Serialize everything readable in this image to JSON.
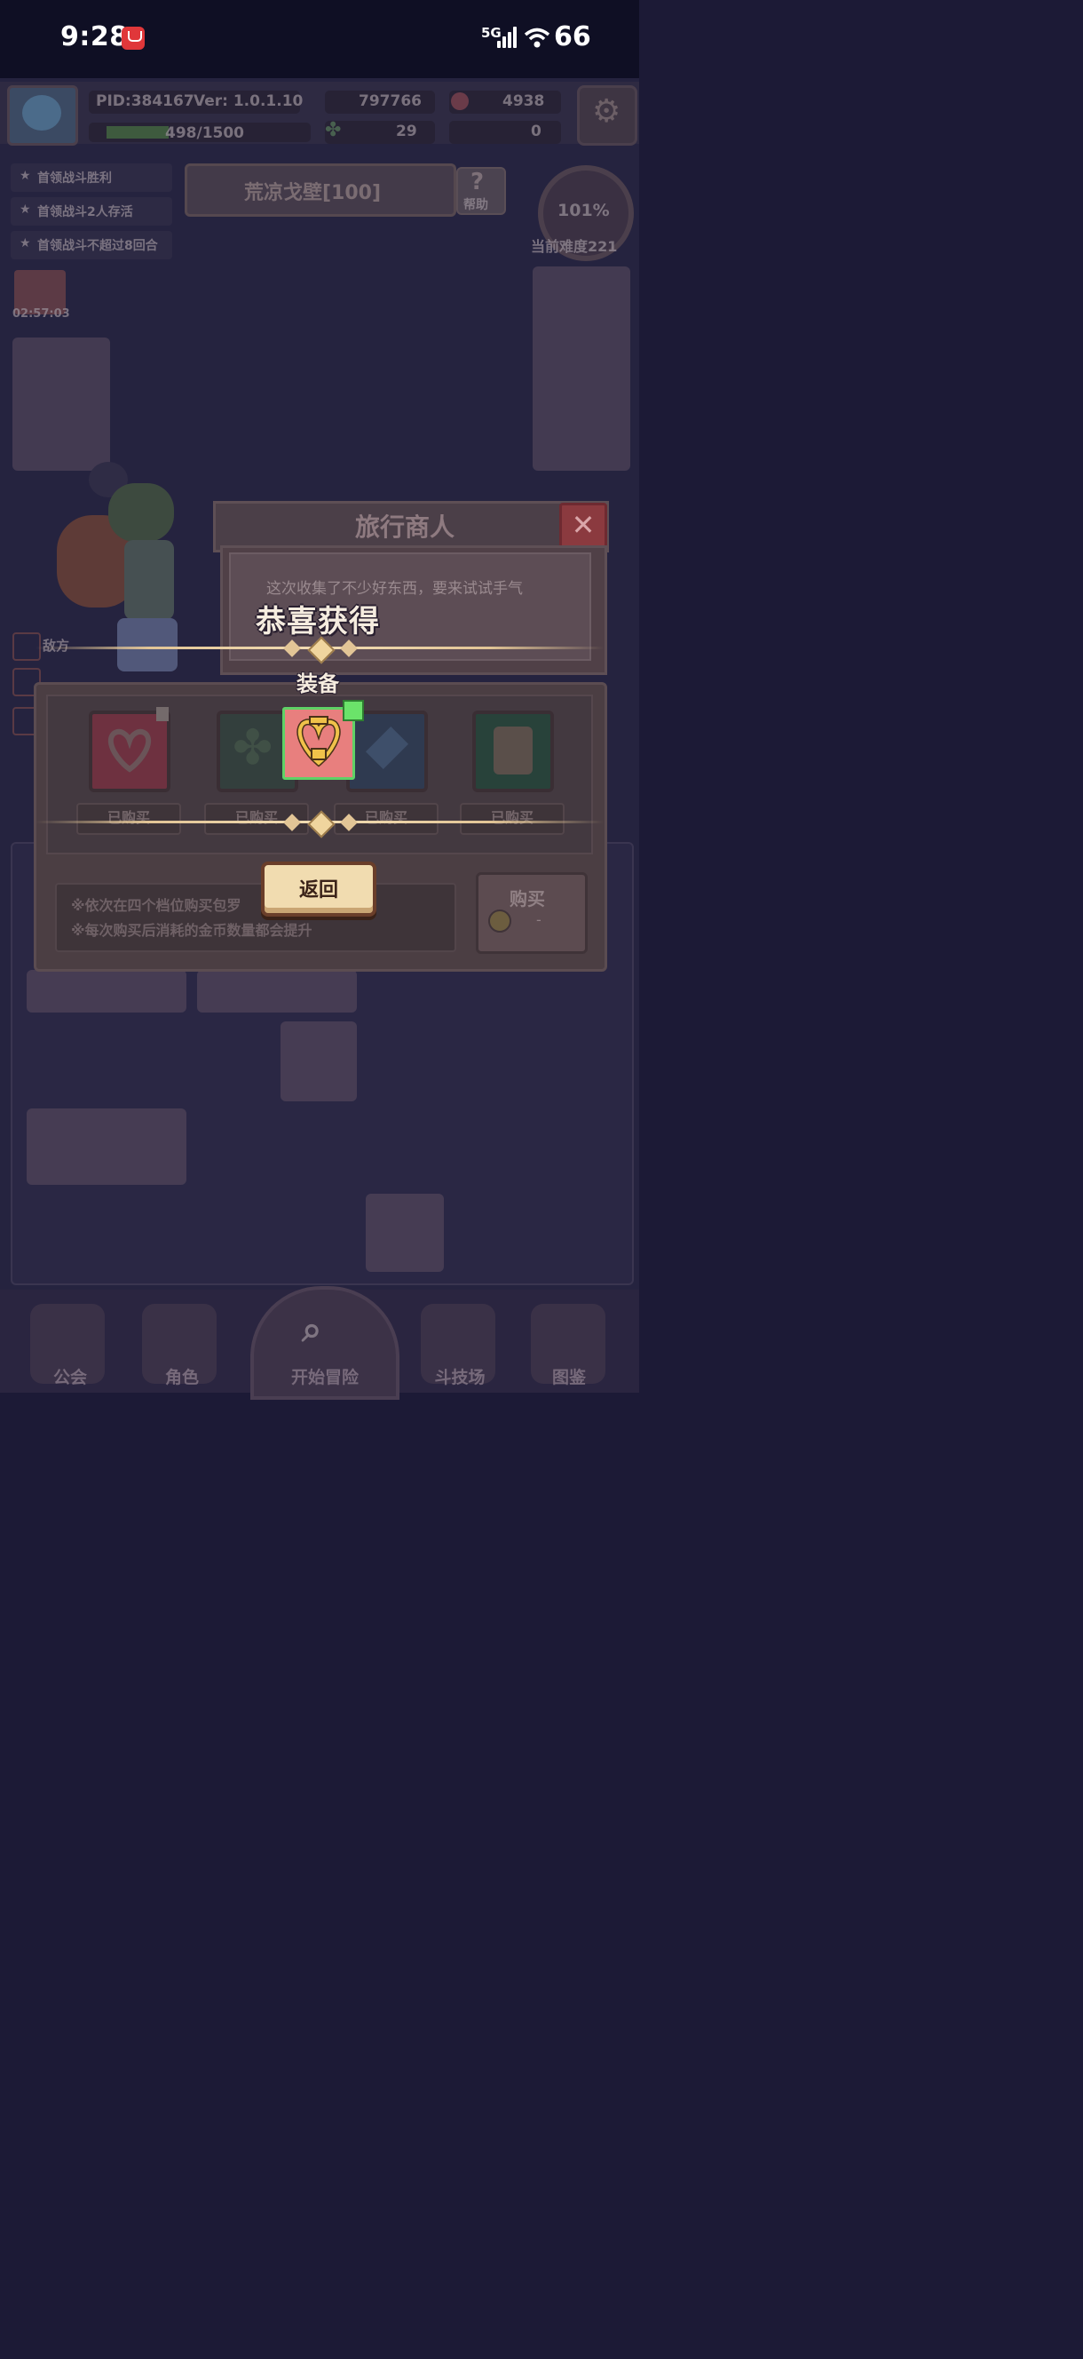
{
  "status_bar": {
    "time": "9:28",
    "network": "5G",
    "battery": "66"
  },
  "player": {
    "pid": "PID:384167",
    "version": "Ver: 1.0.1.10",
    "exp": "498/1500",
    "gold": "797766",
    "gems": "4938",
    "clover": "29",
    "key": "0"
  },
  "stage": {
    "title": "荒凉戈壁[100]",
    "help": "帮助",
    "difficulty_percent": "101%",
    "difficulty": "当前难度221"
  },
  "quests": [
    "首领战斗胜利",
    "首领战斗2人存活",
    "首领战斗不超过8回合"
  ],
  "gift_timer": "02:57:03",
  "battle_hint": "敌方",
  "merchant": {
    "title": "旅行商人",
    "close": "✕",
    "dialog": "这次收集了不少好东西，要来试试手气",
    "slots": [
      {
        "status": "已购买",
        "color": "#8a3a48"
      },
      {
        "status": "已购买",
        "color": "#3b4b48"
      },
      {
        "status": "已购买",
        "color": "#37435a"
      },
      {
        "status": "已购买",
        "color": "#2f4a3a"
      }
    ],
    "notes": [
      "※依次在四个档位购买包罗",
      "※每次购买后消耗的金币数量都会提升"
    ],
    "buy_label": "购买",
    "buy_price": "-"
  },
  "reward": {
    "title": "恭喜获得",
    "category": "装备",
    "return_label": "返回",
    "item_color": "#e87f7e",
    "item_border": "#5fd266"
  },
  "nav": {
    "guild": "公会",
    "character": "角色",
    "adventure": "开始冒险",
    "arena": "斗技场",
    "codex": "图鉴"
  },
  "colors": {
    "overlay_bg": "#25233f",
    "gold_accent": "#e2c596",
    "button_face": "#f1dcb0"
  }
}
